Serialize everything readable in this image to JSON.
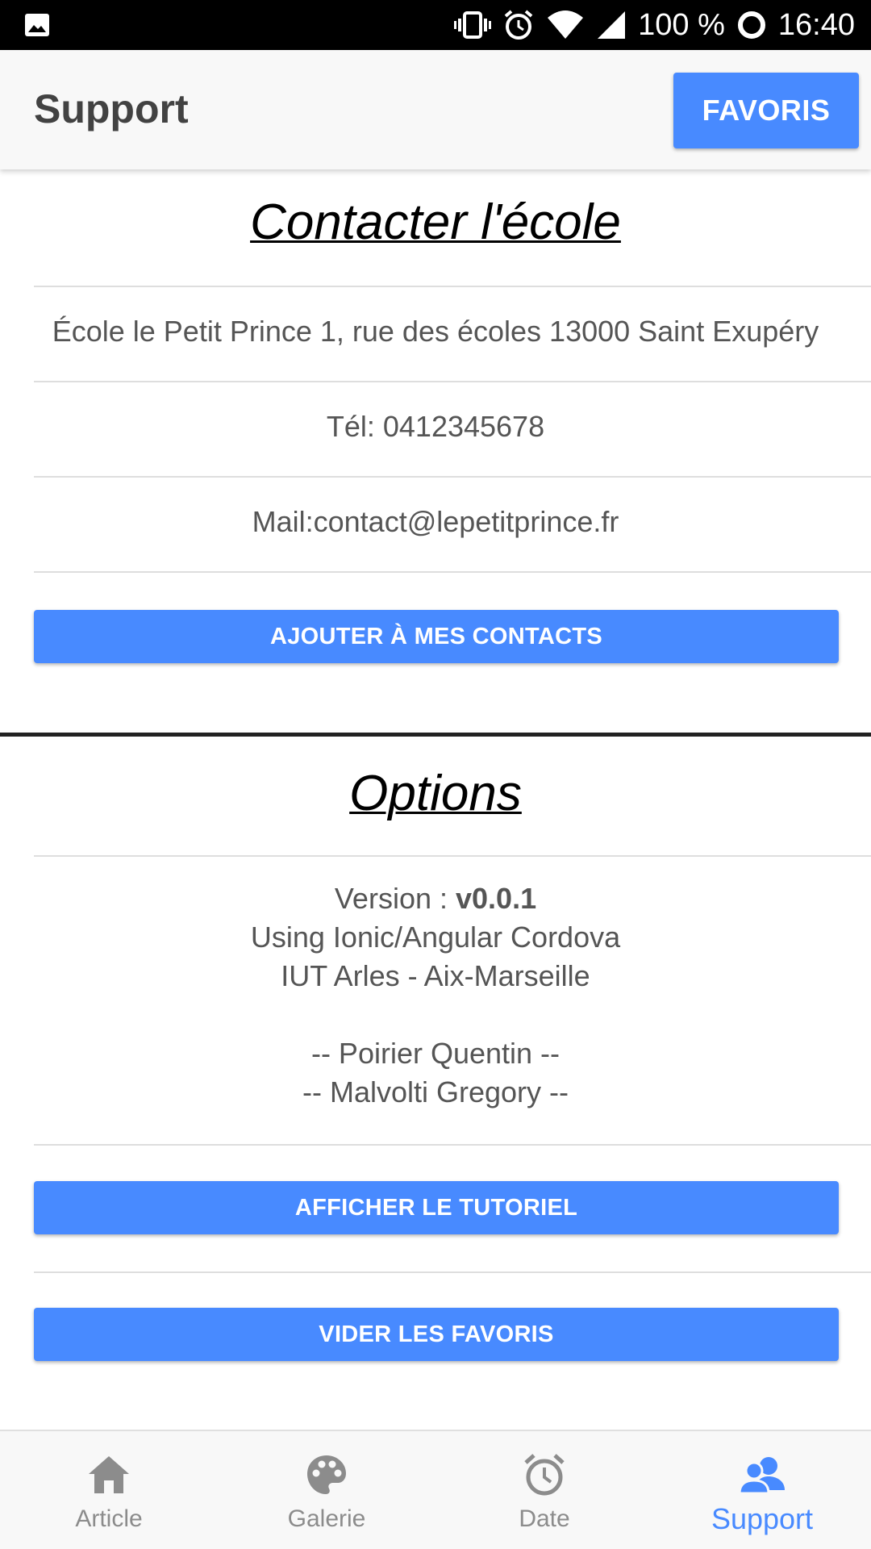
{
  "status_bar": {
    "battery_text": "100 %",
    "time": "16:40",
    "icons": [
      "image-icon",
      "vibrate-icon",
      "alarm-icon",
      "wifi-icon",
      "signal-icon",
      "battery-ring-icon"
    ]
  },
  "header": {
    "title": "Support",
    "favoris_label": "FAVORIS"
  },
  "contact": {
    "title": "Contacter l'école",
    "address": "École le Petit Prince 1, rue des écoles 13000 Saint Exupéry",
    "phone": "Tél: 0412345678",
    "mail": "Mail:contact@lepetitprince.fr",
    "add_button": "AJOUTER À MES CONTACTS"
  },
  "options": {
    "title": "Options",
    "version_label": "Version : ",
    "version_value": "v0.0.1",
    "using": "Using Ionic/Angular Cordova",
    "school": "IUT Arles - Aix-Marseille",
    "author1": "-- Poirier Quentin --",
    "author2": "-- Malvolti Gregory --",
    "tutorial_button": "AFFICHER LE TUTORIEL",
    "clear_button": "VIDER LES FAVORIS"
  },
  "tabs": [
    {
      "label": "Article",
      "icon": "home-icon",
      "active": false
    },
    {
      "label": "Galerie",
      "icon": "palette-icon",
      "active": false
    },
    {
      "label": "Date",
      "icon": "alarm-clock-icon",
      "active": false
    },
    {
      "label": "Support",
      "icon": "people-icon",
      "active": true
    }
  ],
  "colors": {
    "accent": "#488aff",
    "text": "#555555",
    "tab_inactive": "#8c8c8c"
  }
}
